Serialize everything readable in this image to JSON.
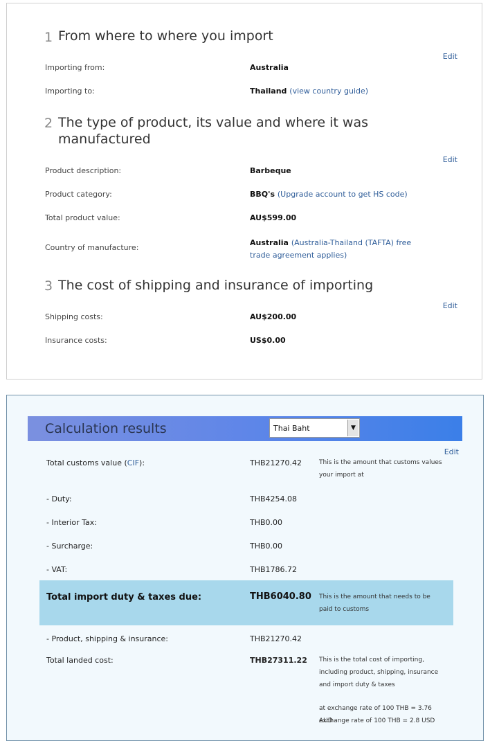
{
  "sections": [
    {
      "num": "1",
      "title": "From where to where you import"
    },
    {
      "num": "2",
      "title": "The type of product, its value and where it was manufactured"
    },
    {
      "num": "3",
      "title": "The cost of shipping and insurance of importing"
    }
  ],
  "edit_label": "Edit",
  "import": {
    "from_label": "Importing from:",
    "from_value": "Australia",
    "to_label": "Importing to:",
    "to_value": "Thailand",
    "to_link": "(view country guide)"
  },
  "product": {
    "desc_label": "Product description:",
    "desc_value": "Barbeque",
    "cat_label": "Product category:",
    "cat_value": "BBQ's",
    "cat_link": "(Upgrade account to get HS code)",
    "value_label": "Total product value:",
    "value_value": "AU$599.00",
    "country_label": "Country of manufacture:",
    "country_value": "Australia",
    "country_link": "(Australia-Thailand (TAFTA) free trade agreement applies)"
  },
  "shipping": {
    "ship_label": "Shipping costs:",
    "ship_value": "AU$200.00",
    "ins_label": "Insurance costs:",
    "ins_value": "US$0.00"
  },
  "results": {
    "title": "Calculation results",
    "currency": "Thai Baht",
    "customs_label_pre": "Total customs value (",
    "customs_label_link": "CIF",
    "customs_label_post": "):",
    "customs_value": "THB21270.42",
    "customs_note": "This is the amount that customs values your import at",
    "duty_label": "- Duty:",
    "duty_value": "THB4254.08",
    "interior_label": "- Interior Tax:",
    "interior_value": "THB0.00",
    "surcharge_label": "- Surcharge:",
    "surcharge_value": "THB0.00",
    "vat_label": "- VAT:",
    "vat_value": "THB1786.72",
    "total_label": "Total import duty & taxes due:",
    "total_value": "THB6040.80",
    "total_note": "This is the amount that needs to be paid to customs",
    "psi_label": "- Product, shipping & insurance:",
    "psi_value": "THB21270.42",
    "landed_label": "Total landed cost:",
    "landed_value": "THB27311.22",
    "landed_note": "This is the total cost of importing, including product, shipping, insurance and import duty & taxes",
    "rate_aud": "at exchange rate of 100 THB = 3.76 AUD",
    "rate_usd": "exchange rate of 100 THB = 2.8 USD"
  }
}
